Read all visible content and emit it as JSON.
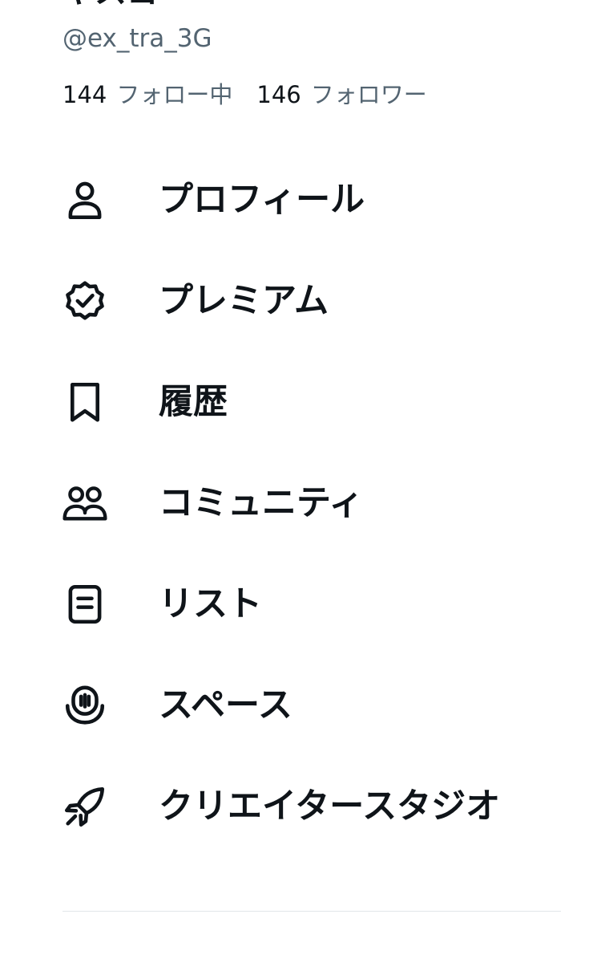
{
  "profile": {
    "name_clipped": "ヤスヨ",
    "handle": "@ex_tra_3G",
    "following_count": "144",
    "following_label": "フォロー中",
    "followers_count": "146",
    "followers_label": "フォロワー"
  },
  "menu": {
    "items": [
      {
        "label": "プロフィール",
        "icon": "person-icon"
      },
      {
        "label": "プレミアム",
        "icon": "verified-badge-icon"
      },
      {
        "label": "履歴",
        "icon": "bookmark-icon"
      },
      {
        "label": "コミュニティ",
        "icon": "people-icon"
      },
      {
        "label": "リスト",
        "icon": "list-icon"
      },
      {
        "label": "スペース",
        "icon": "spaces-icon"
      },
      {
        "label": "クリエイタースタジオ",
        "icon": "rocket-icon"
      }
    ]
  },
  "colors": {
    "text_primary": "#0f1419",
    "text_secondary": "#536471",
    "divider": "#e2e6e9",
    "background": "#ffffff"
  }
}
